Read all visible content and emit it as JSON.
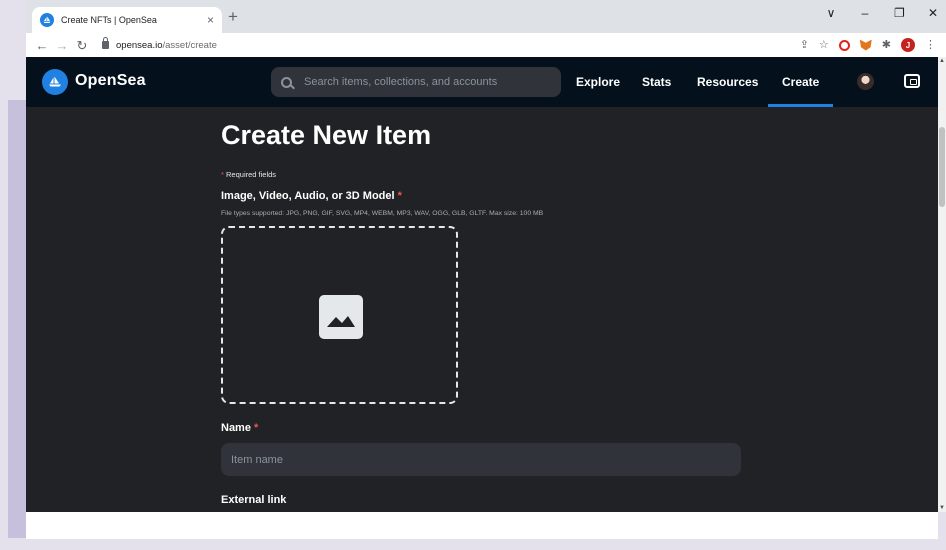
{
  "browser": {
    "tab_title": "Create NFTs | OpenSea",
    "tab_close": "×",
    "new_tab": "+",
    "window_controls": [
      "∨",
      "–",
      "❐",
      "✕"
    ],
    "url_host": "opensea.io",
    "url_path": "/asset/create",
    "profile_initial": "J"
  },
  "header": {
    "brand": "OpenSea",
    "search_placeholder": "Search items, collections, and accounts",
    "nav": [
      "Explore",
      "Stats",
      "Resources",
      "Create"
    ],
    "active_nav": "Create",
    "accent_color": "#2081e2",
    "background_color": "#04111d"
  },
  "form": {
    "title": "Create New Item",
    "required_star": "*",
    "required_note": "Required fields",
    "upload_label": "Image, Video, Audio, or 3D Model",
    "upload_hint": "File types supported: JPG, PNG, GIF, SVG, MP4, WEBM, MP3, WAV, OGG, GLB, GLTF. Max size: 100 MB",
    "upload_icon": "image-placeholder-icon",
    "name_label": "Name",
    "name_placeholder": "Item name",
    "external_link_label": "External link"
  }
}
